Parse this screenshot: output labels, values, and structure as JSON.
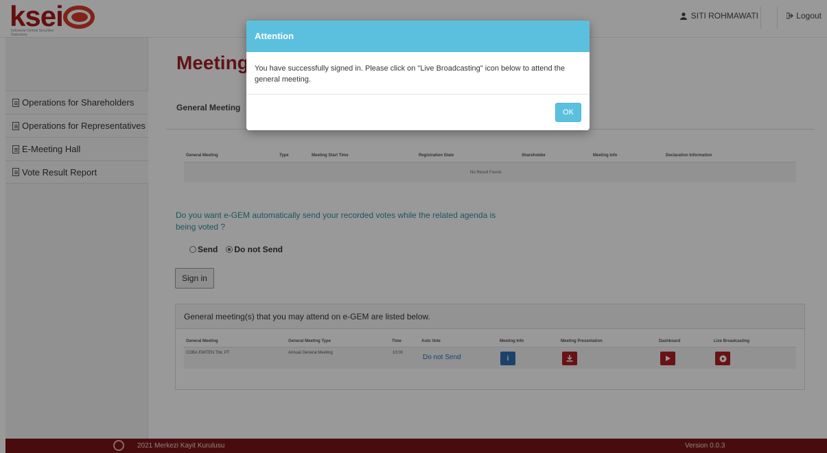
{
  "header": {
    "logo_text": "ksei",
    "logo_subtitle": "Indonesia Central Securities Depository",
    "user_name": "SITI ROHMAWATI",
    "logout_label": "Logout"
  },
  "sidebar": {
    "items": [
      {
        "label": "Operations for Shareholders"
      },
      {
        "label": "Operations for Representatives"
      },
      {
        "label": "E-Meeting Hall"
      },
      {
        "label": "Vote Result Report"
      }
    ]
  },
  "main": {
    "title": "Meeting",
    "tab_label": "General Meeting",
    "registration_table": {
      "headers": [
        "General Meeting",
        "Type",
        "Meeting Start Time",
        "Registration State",
        "Shareholder",
        "Meeting Info",
        "Declaration Information"
      ],
      "empty_text": "No Result Found."
    },
    "question": "Do you want e-GEM automatically send your recorded votes while the related agenda is being voted ?",
    "radio_options": [
      {
        "label": "Send",
        "selected": false
      },
      {
        "label": "Do not Send",
        "selected": true
      }
    ],
    "signin_label": "Sign in",
    "meetings_panel": {
      "heading": "General meeting(s) that you may attend on e-GEM are listed below.",
      "headers": [
        "General Meeting",
        "General Meeting Type",
        "Time",
        "Auto Vote",
        "Meeting Info",
        "Meeting Presentation",
        "Dashboard",
        "Live Broadcasting"
      ],
      "rows": [
        {
          "general_meeting": "COBA EMITEN Tbk, PT",
          "type": "Annual General Meeting",
          "time": "10:00",
          "auto_vote": "Do not Send"
        }
      ]
    }
  },
  "footer": {
    "copyright": "2021 Merkezi Kayit Kurulusu",
    "version": "Version 0.0.3"
  },
  "modal": {
    "title": "Attention",
    "message": "You have successfully signed in. Please click on \"Live Broadcasting\" icon below to attend the general meeting.",
    "ok_label": "OK"
  },
  "colors": {
    "brand_red": "#a02024",
    "modal_header": "#5bc0de",
    "footer_bg": "#7a1518",
    "question_text": "#2f8fa0"
  }
}
